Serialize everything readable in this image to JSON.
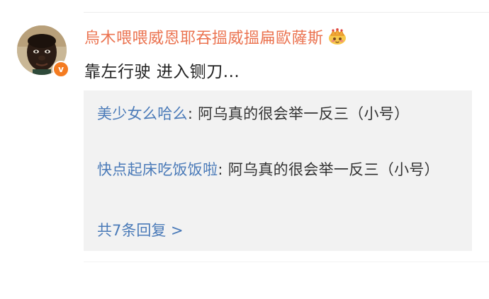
{
  "comment": {
    "username": "烏木喂喂威恩耶吞搵威搵扁歐薩斯",
    "badge_icon": "crown-icon",
    "verified_mark": "v",
    "text": "靠左行驶 进入铡刀..."
  },
  "replies": [
    {
      "user": "美少女么哈么",
      "separator": ": ",
      "text": "阿乌真的很会举一反三（小号）"
    },
    {
      "user": "快点起床吃饭饭啦",
      "separator": ": ",
      "text": "阿乌真的很会举一反三（小号）"
    }
  ],
  "more_replies_label": "共7条回复 >",
  "colors": {
    "username": "#eb7350",
    "link": "#4a7ab8",
    "text": "#222222",
    "reply_background": "#f2f2f2",
    "verified_badge": "#f47b20"
  }
}
